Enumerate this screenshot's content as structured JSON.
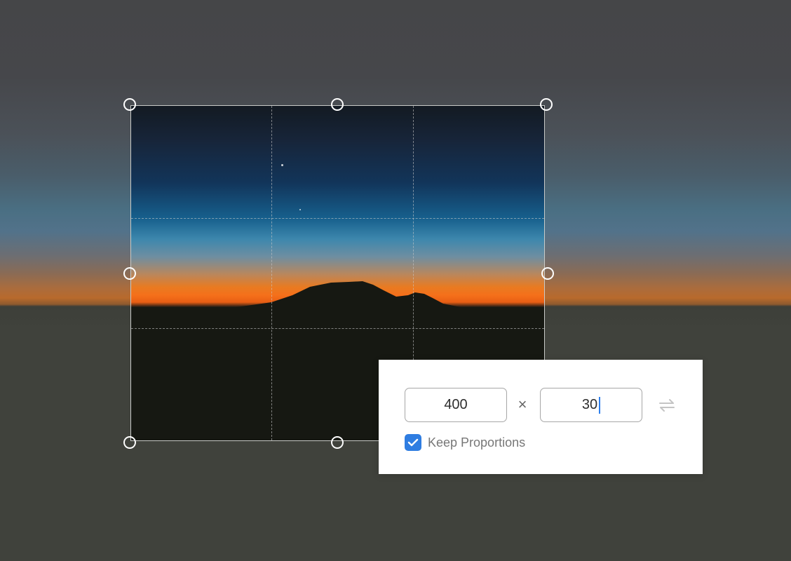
{
  "crop_editor": {
    "handles": [
      "top-left",
      "top-center",
      "top-right",
      "middle-left",
      "middle-right",
      "bottom-left",
      "bottom-center"
    ]
  },
  "resize_dialog": {
    "width_value": "400",
    "height_value": "30",
    "times_symbol": "×",
    "keep_proportions_label": "Keep Proportions",
    "keep_proportions_checked": true,
    "swap_icon": "swap-arrows-icon"
  },
  "colors": {
    "accent": "#2f7de1",
    "caret": "#2f80ed"
  }
}
